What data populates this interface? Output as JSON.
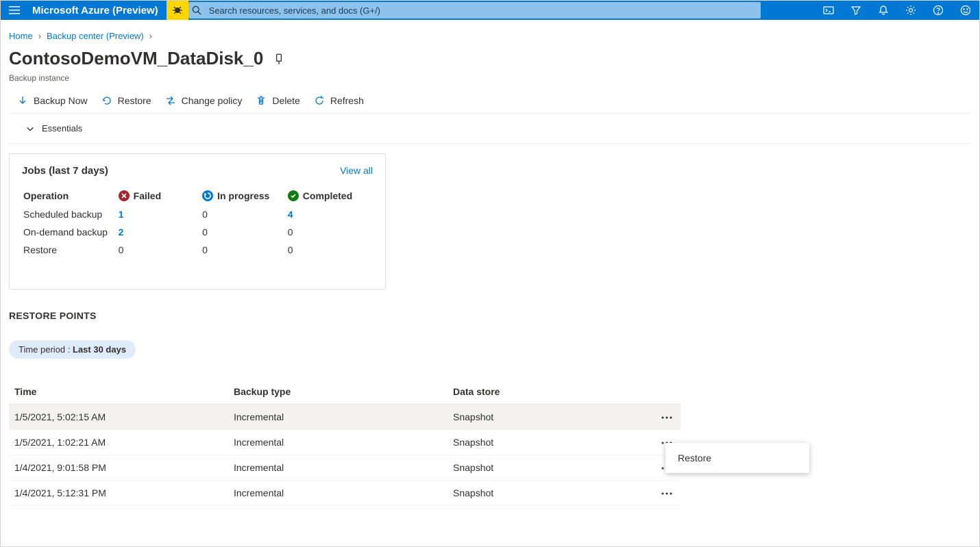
{
  "top": {
    "brand": "Microsoft Azure (Preview)",
    "search_placeholder": "Search resources, services, and docs (G+/)"
  },
  "breadcrumbs": [
    {
      "label": "Home"
    },
    {
      "label": "Backup center (Preview)"
    }
  ],
  "page": {
    "title": "ContosoDemoVM_DataDisk_0",
    "subtitle": "Backup instance"
  },
  "toolbar": {
    "backup_now": "Backup Now",
    "restore": "Restore",
    "change_policy": "Change policy",
    "delete": "Delete",
    "refresh": "Refresh"
  },
  "essentials": {
    "label": "Essentials"
  },
  "jobs": {
    "title": "Jobs (last 7 days)",
    "view_all": "View all",
    "op_header": "Operation",
    "status_headers": {
      "failed": "Failed",
      "in_progress": "In progress",
      "completed": "Completed"
    },
    "rows": [
      {
        "label": "Scheduled backup",
        "failed": "1",
        "failed_link": true,
        "in_progress": "0",
        "completed": "4",
        "completed_link": true
      },
      {
        "label": "On-demand backup",
        "failed": "2",
        "failed_link": true,
        "in_progress": "0",
        "completed": "0"
      },
      {
        "label": "Restore",
        "failed": "0",
        "failed_link": false,
        "in_progress": "0",
        "completed": "0"
      }
    ]
  },
  "restore_points": {
    "heading": "RESTORE POINTS",
    "filter_label": "Time period : ",
    "filter_value": "Last 30 days",
    "columns": {
      "time": "Time",
      "type": "Backup type",
      "store": "Data store"
    },
    "rows": [
      {
        "time": "1/5/2021, 5:02:15 AM",
        "type": "Incremental",
        "store": "Snapshot",
        "hover": true
      },
      {
        "time": "1/5/2021, 1:02:21 AM",
        "type": "Incremental",
        "store": "Snapshot"
      },
      {
        "time": "1/4/2021, 9:01:58 PM",
        "type": "Incremental",
        "store": "Snapshot"
      },
      {
        "time": "1/4/2021, 5:12:31 PM",
        "type": "Incremental",
        "store": "Snapshot"
      }
    ]
  },
  "context_menu": {
    "restore": "Restore"
  }
}
